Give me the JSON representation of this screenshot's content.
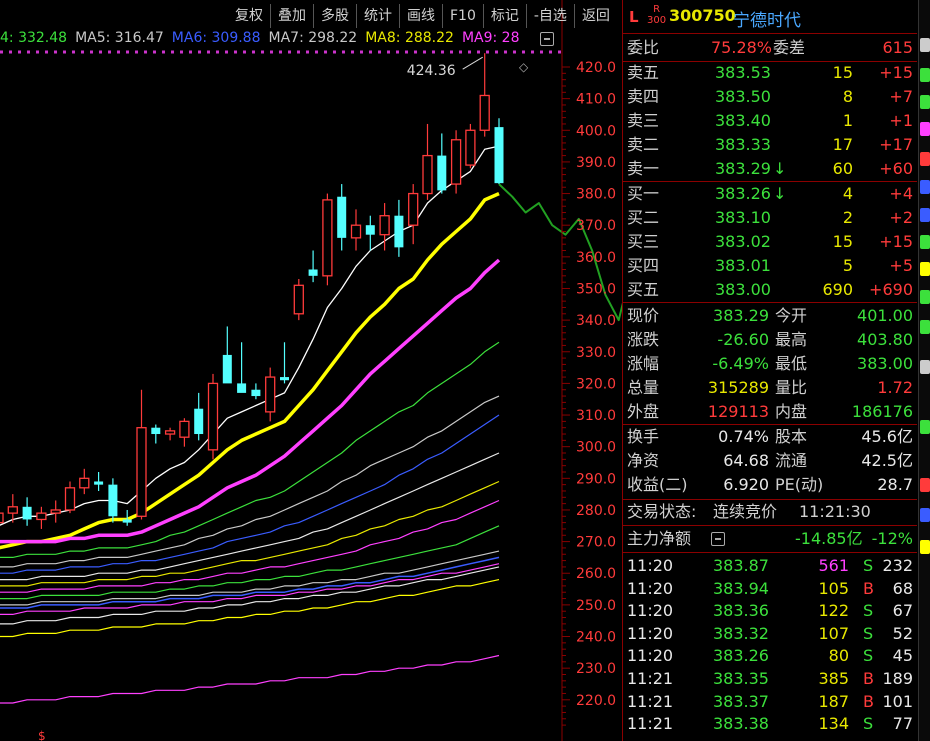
{
  "toolbar": {
    "buttons": [
      "复权",
      "叠加",
      "多股",
      "统计",
      "画线",
      "F10",
      "标记",
      "-自选",
      "返回"
    ]
  },
  "ma_legend": [
    {
      "text": "4: 332.48",
      "color": "#3ce03c"
    },
    {
      "text": "MA5: 316.47",
      "color": "#c8c8c8"
    },
    {
      "text": "MA6: 309.88",
      "color": "#3a5cff"
    },
    {
      "text": "MA7: 298.22",
      "color": "#c8c8c8"
    },
    {
      "text": "MA8: 288.22",
      "color": "#e8e800"
    },
    {
      "text": "MA9: 28",
      "color": "#ff40ff"
    }
  ],
  "chart_data": {
    "type": "candlestick",
    "y_axis": {
      "min": 215,
      "max": 425,
      "ticks": [
        420.0,
        410.0,
        400.0,
        390.0,
        380.0,
        370.0,
        360.0,
        350.0,
        340.0,
        330.0,
        320.0,
        310.0,
        300.0,
        290.0,
        280.0,
        270.0,
        260.0,
        250.0,
        240.0,
        230.0,
        220.0
      ]
    },
    "annotation": {
      "text": "424.36",
      "value": 424.36
    },
    "candles": [
      {
        "o": 276,
        "h": 282,
        "l": 273,
        "c": 279
      },
      {
        "o": 279,
        "h": 285,
        "l": 276,
        "c": 281
      },
      {
        "o": 281,
        "h": 284,
        "l": 275,
        "c": 277
      },
      {
        "o": 277,
        "h": 281,
        "l": 274,
        "c": 279
      },
      {
        "o": 279,
        "h": 283,
        "l": 276,
        "c": 280
      },
      {
        "o": 280,
        "h": 289,
        "l": 279,
        "c": 287
      },
      {
        "o": 287,
        "h": 293,
        "l": 285,
        "c": 290
      },
      {
        "o": 289,
        "h": 292,
        "l": 286,
        "c": 288
      },
      {
        "o": 288,
        "h": 290,
        "l": 276,
        "c": 278
      },
      {
        "o": 277,
        "h": 280,
        "l": 275,
        "c": 276
      },
      {
        "o": 278,
        "h": 318,
        "l": 277,
        "c": 306
      },
      {
        "o": 306,
        "h": 307,
        "l": 301,
        "c": 304
      },
      {
        "o": 304,
        "h": 306,
        "l": 302,
        "c": 305
      },
      {
        "o": 303,
        "h": 309,
        "l": 300,
        "c": 308
      },
      {
        "o": 312,
        "h": 317,
        "l": 302,
        "c": 304
      },
      {
        "o": 299,
        "h": 323,
        "l": 296,
        "c": 320
      },
      {
        "o": 329,
        "h": 338,
        "l": 321,
        "c": 320
      },
      {
        "o": 320,
        "h": 333,
        "l": 318,
        "c": 317
      },
      {
        "o": 318,
        "h": 320,
        "l": 315,
        "c": 316
      },
      {
        "o": 311,
        "h": 325,
        "l": 308,
        "c": 322
      },
      {
        "o": 322,
        "h": 333,
        "l": 320,
        "c": 321
      },
      {
        "o": 342,
        "h": 353,
        "l": 340,
        "c": 351
      },
      {
        "o": 356,
        "h": 362,
        "l": 352,
        "c": 354
      },
      {
        "o": 354,
        "h": 380,
        "l": 351,
        "c": 378
      },
      {
        "o": 379,
        "h": 383,
        "l": 362,
        "c": 366
      },
      {
        "o": 366,
        "h": 375,
        "l": 362,
        "c": 370
      },
      {
        "o": 370,
        "h": 373,
        "l": 362,
        "c": 367
      },
      {
        "o": 367,
        "h": 377,
        "l": 362,
        "c": 373
      },
      {
        "o": 373,
        "h": 378,
        "l": 360,
        "c": 363
      },
      {
        "o": 370,
        "h": 383,
        "l": 364,
        "c": 380
      },
      {
        "o": 380,
        "h": 402,
        "l": 378,
        "c": 392
      },
      {
        "o": 392,
        "h": 399,
        "l": 380,
        "c": 381
      },
      {
        "o": 383,
        "h": 400,
        "l": 380,
        "c": 397
      },
      {
        "o": 389,
        "h": 402,
        "l": 388,
        "c": 400
      },
      {
        "o": 400,
        "h": 424.36,
        "l": 398,
        "c": 411
      },
      {
        "o": 401,
        "h": 403.8,
        "l": 383,
        "c": 383.29
      }
    ],
    "ma_lines": [
      {
        "name": "MA",
        "color": "#ffffff",
        "width": 1.3,
        "values": [
          275,
          277,
          278,
          278,
          279,
          280,
          282,
          283,
          283,
          282,
          286,
          290,
          293,
          295,
          299,
          304,
          309,
          311,
          313,
          315,
          317,
          325,
          334,
          344,
          350,
          357,
          362,
          365,
          368,
          370,
          377,
          381,
          384,
          387,
          394,
          395
        ]
      },
      {
        "name": "MA",
        "color": "#ffff00",
        "width": 3.5,
        "values": [
          268,
          269,
          270,
          270,
          271,
          272,
          274,
          276,
          277,
          277,
          279,
          282,
          285,
          288,
          291,
          295,
          299,
          302,
          304,
          306,
          308,
          313,
          318,
          324,
          330,
          336,
          341,
          345,
          350,
          353,
          359,
          364,
          368,
          372,
          378,
          380
        ]
      },
      {
        "name": "MA",
        "color": "#ff40ff",
        "width": 3.5,
        "values": [
          270,
          270,
          270,
          270,
          270,
          271,
          271,
          272,
          272,
          272,
          273,
          275,
          277,
          279,
          281,
          284,
          287,
          289,
          291,
          294,
          297,
          301,
          305,
          309,
          313,
          318,
          323,
          327,
          331,
          335,
          339,
          343,
          347,
          350,
          355,
          359
        ]
      },
      {
        "name": "MA",
        "color": "#3ce03c",
        "width": 1.2,
        "values": [
          265,
          265,
          266,
          266,
          266,
          267,
          267,
          268,
          268,
          268,
          269,
          270,
          272,
          273,
          275,
          277,
          279,
          281,
          283,
          284,
          286,
          289,
          292,
          295,
          298,
          302,
          305,
          308,
          311,
          313,
          317,
          320,
          323,
          326,
          330,
          333
        ]
      },
      {
        "name": "MA",
        "color": "#c8c8c8",
        "width": 1.2,
        "values": [
          262,
          262,
          263,
          263,
          263,
          264,
          264,
          265,
          265,
          265,
          266,
          267,
          268,
          269,
          271,
          272,
          274,
          275,
          277,
          278,
          280,
          282,
          284,
          286,
          289,
          291,
          294,
          296,
          298,
          300,
          303,
          305,
          308,
          311,
          314,
          316
        ]
      },
      {
        "name": "MA",
        "color": "#3a5cff",
        "width": 1.2,
        "values": [
          260,
          260,
          261,
          261,
          261,
          262,
          262,
          262,
          263,
          263,
          264,
          264,
          265,
          266,
          267,
          268,
          270,
          271,
          272,
          273,
          275,
          276,
          278,
          280,
          282,
          284,
          286,
          288,
          291,
          293,
          296,
          298,
          301,
          304,
          307,
          310
        ]
      },
      {
        "name": "MA",
        "color": "#e8e8e8",
        "width": 1.2,
        "values": [
          258,
          258,
          258,
          259,
          259,
          259,
          259,
          260,
          260,
          260,
          261,
          261,
          262,
          263,
          264,
          265,
          266,
          267,
          268,
          269,
          270,
          271,
          273,
          274,
          276,
          278,
          280,
          282,
          284,
          286,
          288,
          290,
          292,
          294,
          296,
          298
        ]
      },
      {
        "name": "MA",
        "color": "#e8e800",
        "width": 1.2,
        "values": [
          256,
          256,
          256,
          257,
          257,
          257,
          257,
          258,
          258,
          258,
          259,
          259,
          260,
          260,
          261,
          262,
          263,
          264,
          264,
          265,
          266,
          267,
          268,
          269,
          271,
          272,
          274,
          275,
          277,
          278,
          280,
          281,
          283,
          285,
          287,
          289
        ]
      },
      {
        "name": "MA",
        "color": "#ff40ff",
        "width": 1.2,
        "values": [
          254,
          254,
          254,
          255,
          255,
          255,
          255,
          256,
          256,
          256,
          256,
          257,
          257,
          258,
          258,
          259,
          260,
          260,
          261,
          262,
          262,
          263,
          264,
          265,
          266,
          267,
          269,
          270,
          271,
          273,
          274,
          276,
          277,
          279,
          281,
          283
        ]
      },
      {
        "name": "MA",
        "color": "#3ce03c",
        "width": 1.2,
        "values": [
          252,
          252,
          252,
          253,
          253,
          253,
          253,
          253,
          254,
          254,
          254,
          254,
          255,
          255,
          256,
          256,
          257,
          257,
          258,
          258,
          259,
          259,
          260,
          261,
          261,
          262,
          263,
          264,
          265,
          266,
          267,
          268,
          269,
          271,
          273,
          275
        ]
      },
      {
        "name": "MA",
        "color": "#c8c8c8",
        "width": 1.2,
        "values": [
          250,
          250,
          250,
          251,
          251,
          251,
          251,
          251,
          252,
          252,
          252,
          252,
          253,
          253,
          253,
          254,
          254,
          254,
          255,
          255,
          256,
          256,
          257,
          257,
          258,
          258,
          259,
          260,
          260,
          261,
          262,
          263,
          264,
          265,
          266,
          267
        ]
      },
      {
        "name": "MA",
        "color": "#ff40ff",
        "width": 1.2,
        "values": [
          247,
          247,
          248,
          248,
          248,
          248,
          249,
          249,
          249,
          249,
          250,
          250,
          250,
          251,
          251,
          251,
          252,
          252,
          253,
          253,
          253,
          254,
          254,
          255,
          255,
          256,
          256,
          257,
          258,
          258,
          259,
          260,
          260,
          261,
          262,
          263
        ]
      },
      {
        "name": "MA",
        "color": "#3a5cff",
        "width": 1.5,
        "values": [
          249,
          249,
          249,
          250,
          250,
          250,
          250,
          250,
          251,
          251,
          251,
          251,
          252,
          252,
          252,
          253,
          253,
          253,
          254,
          254,
          254,
          255,
          255,
          256,
          256,
          257,
          257,
          258,
          259,
          259,
          260,
          261,
          262,
          263,
          264,
          265
        ]
      },
      {
        "name": "MA",
        "color": "#e8e8e8",
        "width": 1.2,
        "values": [
          244,
          244,
          245,
          245,
          245,
          246,
          246,
          246,
          247,
          247,
          247,
          248,
          248,
          248,
          249,
          249,
          250,
          250,
          251,
          251,
          252,
          252,
          253,
          253,
          254,
          254,
          255,
          256,
          256,
          257,
          258,
          258,
          259,
          260,
          261,
          262
        ]
      },
      {
        "name": "MA",
        "color": "#ffff00",
        "width": 1.2,
        "values": [
          240,
          240,
          241,
          241,
          241,
          242,
          242,
          242,
          243,
          243,
          243,
          244,
          244,
          244,
          245,
          245,
          246,
          246,
          247,
          247,
          248,
          248,
          249,
          249,
          250,
          251,
          251,
          252,
          253,
          253,
          254,
          255,
          256,
          256,
          257,
          258
        ]
      },
      {
        "name": "MA",
        "color": "#ff40ff",
        "width": 1.2,
        "values": [
          219,
          219,
          220,
          220,
          220,
          221,
          221,
          221,
          222,
          222,
          222,
          223,
          223,
          223,
          224,
          224,
          225,
          225,
          225,
          226,
          226,
          227,
          227,
          227,
          228,
          228,
          229,
          229,
          230,
          230,
          231,
          231,
          232,
          232,
          233,
          234
        ]
      }
    ],
    "hand_drawn_line": {
      "color": "#22a022",
      "values": [
        383,
        379,
        374,
        377,
        370,
        367,
        372,
        362,
        348,
        340,
        357,
        342,
        331,
        342,
        348,
        346,
        332,
        325
      ]
    }
  },
  "stock": {
    "l_badge": "L",
    "r_badge_top": "R",
    "r_badge_bottom": "300",
    "code": "300750",
    "name": "宁德时代"
  },
  "weibi": {
    "label1": "委比",
    "value1": "75.28%",
    "label2": "委差",
    "value2": "615"
  },
  "asks": [
    {
      "label": "卖五",
      "price": "383.53",
      "vol": "15",
      "chg": "+15",
      "arrow": ""
    },
    {
      "label": "卖四",
      "price": "383.50",
      "vol": "8",
      "chg": "+7",
      "arrow": ""
    },
    {
      "label": "卖三",
      "price": "383.40",
      "vol": "1",
      "chg": "+1",
      "arrow": ""
    },
    {
      "label": "卖二",
      "price": "383.33",
      "vol": "17",
      "chg": "+17",
      "arrow": ""
    },
    {
      "label": "卖一",
      "price": "383.29",
      "vol": "60",
      "chg": "+60",
      "arrow": "↓"
    }
  ],
  "bids": [
    {
      "label": "买一",
      "price": "383.26",
      "vol": "4",
      "chg": "+4",
      "arrow": "↓"
    },
    {
      "label": "买二",
      "price": "383.10",
      "vol": "2",
      "chg": "+2",
      "arrow": ""
    },
    {
      "label": "买三",
      "price": "383.02",
      "vol": "15",
      "chg": "+15",
      "arrow": ""
    },
    {
      "label": "买四",
      "price": "383.01",
      "vol": "5",
      "chg": "+5",
      "arrow": ""
    },
    {
      "label": "买五",
      "price": "383.00",
      "vol": "690",
      "chg": "+690",
      "arrow": ""
    }
  ],
  "quote": [
    {
      "l1": "现价",
      "v1": "383.29",
      "c1": "green",
      "l2": "今开",
      "v2": "401.00",
      "c2": "green"
    },
    {
      "l1": "涨跌",
      "v1": "-26.60",
      "c1": "green",
      "l2": "最高",
      "v2": "403.80",
      "c2": "green"
    },
    {
      "l1": "涨幅",
      "v1": "-6.49%",
      "c1": "green",
      "l2": "最低",
      "v2": "383.00",
      "c2": "green"
    },
    {
      "l1": "总量",
      "v1": "315289",
      "c1": "yellow",
      "l2": "量比",
      "v2": "1.72",
      "c2": "red"
    },
    {
      "l1": "外盘",
      "v1": "129113",
      "c1": "red",
      "l2": "内盘",
      "v2": "186176",
      "c2": "green"
    }
  ],
  "fundamentals": [
    {
      "l1": "换手",
      "v1": "0.74%",
      "l2": "股本",
      "v2": "45.6亿"
    },
    {
      "l1": "净资",
      "v1": "64.68",
      "l2": "流通",
      "v2": "42.5亿"
    },
    {
      "l1": "收益(二)",
      "v1": "6.920",
      "l2": "PE(动)",
      "v2": "28.7"
    }
  ],
  "status": {
    "label": "交易状态:",
    "value": "连续竞价",
    "time": "11:21:30"
  },
  "main_flow": {
    "label": "主力净额",
    "value": "-14.85亿",
    "pct": "-12%"
  },
  "ticks": [
    {
      "time": "11:20",
      "price": "383.87",
      "vol": "561",
      "vol_color": "magenta",
      "side": "S",
      "num": "232"
    },
    {
      "time": "11:20",
      "price": "383.94",
      "vol": "105",
      "vol_color": "yellow",
      "side": "B",
      "num": "68"
    },
    {
      "time": "11:20",
      "price": "383.36",
      "vol": "122",
      "vol_color": "yellow",
      "side": "S",
      "num": "67"
    },
    {
      "time": "11:20",
      "price": "383.32",
      "vol": "107",
      "vol_color": "yellow",
      "side": "S",
      "num": "52"
    },
    {
      "time": "11:20",
      "price": "383.26",
      "vol": "80",
      "vol_color": "yellow",
      "side": "S",
      "num": "45"
    },
    {
      "time": "11:21",
      "price": "383.35",
      "vol": "385",
      "vol_color": "yellow",
      "side": "B",
      "num": "189"
    },
    {
      "time": "11:21",
      "price": "383.37",
      "vol": "187",
      "vol_color": "yellow",
      "side": "B",
      "num": "101"
    },
    {
      "time": "11:21",
      "price": "383.38",
      "vol": "134",
      "vol_color": "yellow",
      "side": "S",
      "num": "77"
    }
  ],
  "colors": {
    "up": "#ff3b3b",
    "down": "#54ffff",
    "bg": "#000000",
    "axis": "#8b0000"
  }
}
